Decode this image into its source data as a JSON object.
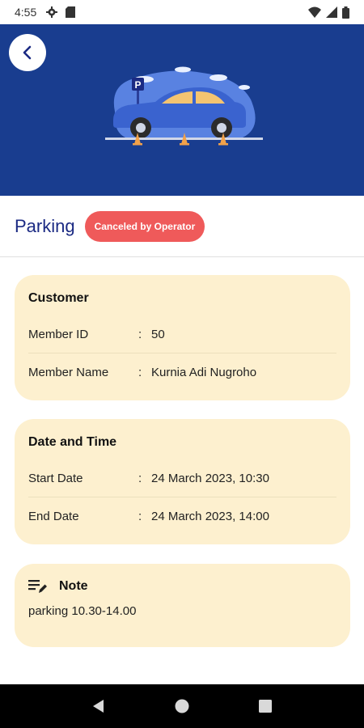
{
  "status_bar": {
    "time": "4:55"
  },
  "header": {
    "title": "Parking",
    "status_badge": "Canceled by Operator"
  },
  "customer": {
    "title": "Customer",
    "rows": [
      {
        "label": "Member ID",
        "colon": ":",
        "value": "50"
      },
      {
        "label": "Member Name",
        "colon": ":",
        "value": "Kurnia Adi Nugroho"
      }
    ]
  },
  "date_time": {
    "title": "Date and Time",
    "rows": [
      {
        "label": "Start Date",
        "colon": ":",
        "value": "24 March 2023, 10:30"
      },
      {
        "label": "End Date",
        "colon": ":",
        "value": "24 March 2023, 14:00"
      }
    ]
  },
  "note": {
    "title": "Note",
    "text": "parking 10.30-14.00"
  },
  "colors": {
    "hero_bg": "#193d8f",
    "card_bg": "#fdf0cf",
    "badge_bg": "#ef5a5a",
    "title": "#1b2a83"
  },
  "icons": [
    "gear-icon",
    "sim-icon",
    "wifi-icon",
    "signal-icon",
    "battery-icon",
    "back-arrow-icon",
    "note-edit-icon",
    "nav-back-icon",
    "nav-home-icon",
    "nav-recents-icon"
  ]
}
